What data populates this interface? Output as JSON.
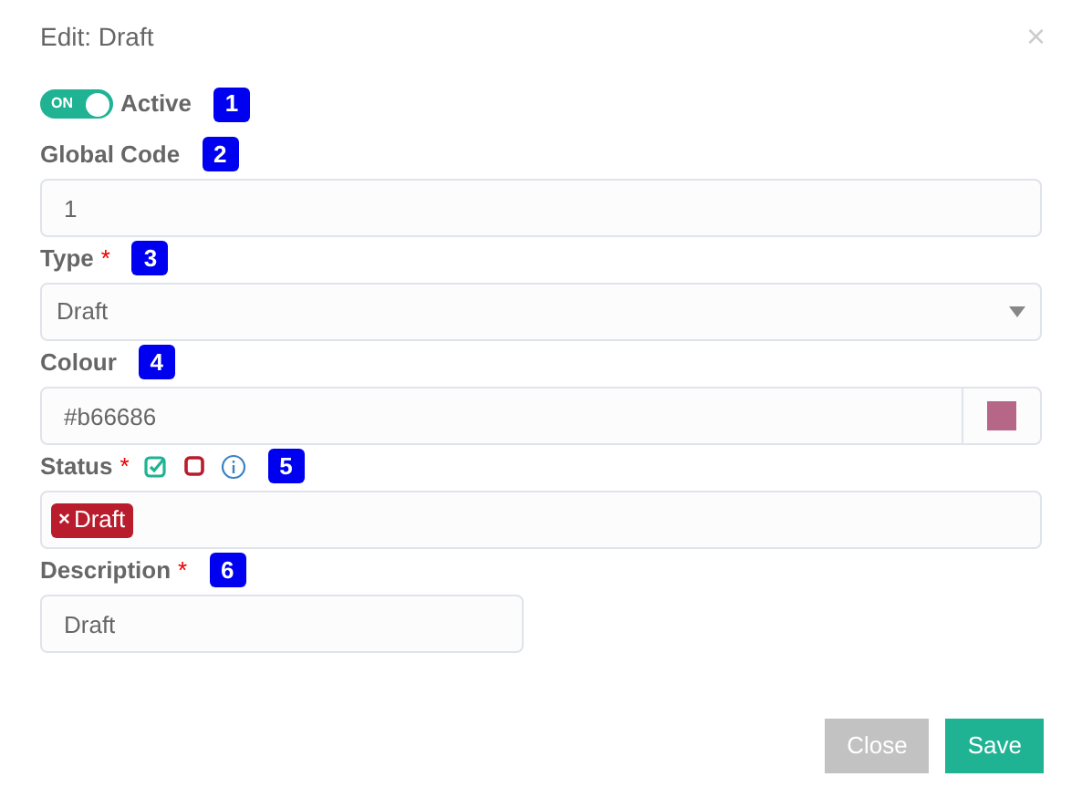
{
  "dialog": {
    "title": "Edit: Draft",
    "close": "×"
  },
  "active": {
    "toggle_text": "ON",
    "on": true,
    "label": "Active",
    "marker": "1"
  },
  "fields": [
    {
      "kind": "text",
      "label": "Global Code",
      "marker": "2",
      "value": "1"
    },
    {
      "kind": "select",
      "label": "Type",
      "required_mark": "*",
      "marker": "3",
      "value": "Draft"
    },
    {
      "kind": "colour",
      "label": "Colour",
      "marker": "4",
      "value": "#b66686",
      "color": "#b66686"
    },
    {
      "kind": "tags",
      "label": "Status",
      "required_mark": "*",
      "marker": "5",
      "tags": [
        {
          "remove": "×",
          "label": "Draft",
          "color": "#b91c2c"
        }
      ]
    },
    {
      "kind": "short",
      "label": "Description",
      "required_mark": "*",
      "marker": "6",
      "value": "Draft"
    }
  ],
  "buttons": [
    {
      "label": "Close",
      "kind": "secondary"
    },
    {
      "label": "Save",
      "kind": "primary"
    }
  ]
}
